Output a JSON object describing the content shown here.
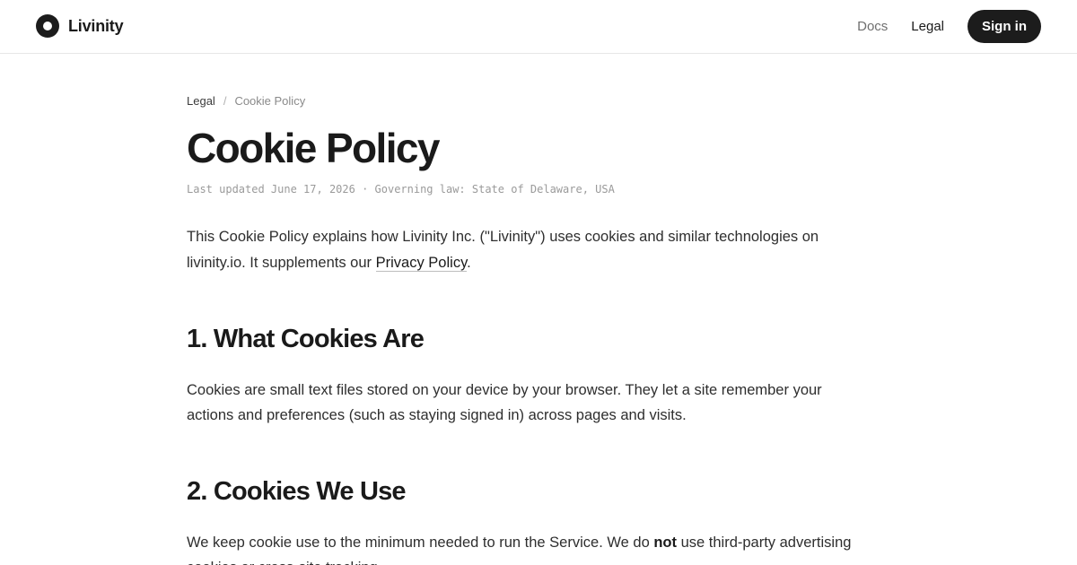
{
  "header": {
    "brand_name": "Livinity",
    "nav": {
      "docs": "Docs",
      "legal": "Legal",
      "signin": "Sign in"
    }
  },
  "breadcrumb": {
    "parent": "Legal",
    "separator": "/",
    "current": "Cookie Policy"
  },
  "page": {
    "title": "Cookie Policy",
    "meta": "Last updated June 17, 2026 · Governing law: State of Delaware, USA",
    "intro_before": "This Cookie Policy explains how Livinity Inc. (\"Livinity\") uses cookies and similar technologies on livinity.io. It supplements our ",
    "intro_link": "Privacy Policy",
    "intro_after": "."
  },
  "sections": [
    {
      "heading": "1. What Cookies Are",
      "body": "Cookies are small text files stored on your device by your browser. They let a site remember your actions and preferences (such as staying signed in) across pages and visits."
    },
    {
      "heading": "2. Cookies We Use",
      "body_before": "We keep cookie use to the minimum needed to run the Service. We do ",
      "body_bold": "not",
      "body_after": " use third-party advertising cookies or cross-site tracking."
    }
  ],
  "colors": {
    "text": "#1a1a1a",
    "muted": "#6f6f6f",
    "button_bg": "#1c1c1c",
    "border": "#e6e6e6"
  }
}
